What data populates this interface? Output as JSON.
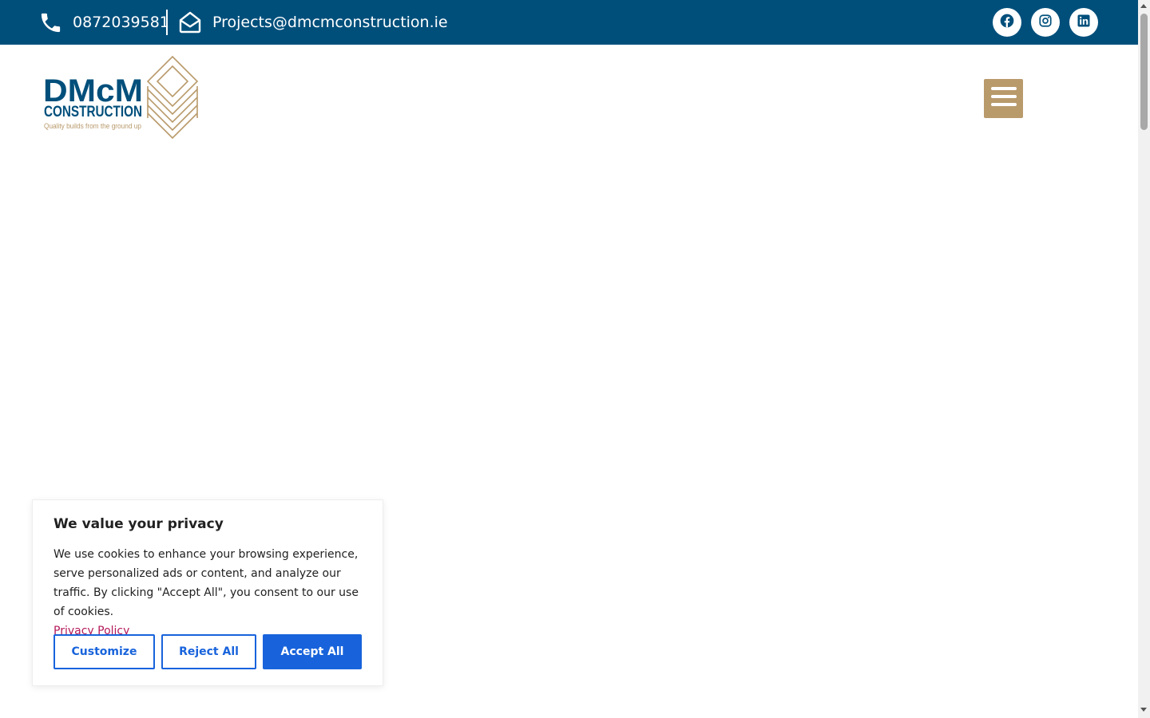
{
  "topbar": {
    "phone": "0872039581",
    "email": "Projects@dmcmconstruction.ie",
    "background": "#004f7b",
    "icons": {
      "phone": "phone-icon",
      "email": "envelope-open-icon",
      "facebook": "facebook-icon",
      "instagram": "instagram-icon",
      "linkedin": "linkedin-icon"
    }
  },
  "logo": {
    "line1": "DMcM",
    "line2": "CONSTRUCTION",
    "tagline": "Quality builds from the ground up"
  },
  "header": {
    "menu_icon": "hamburger-menu-icon",
    "menu_color": "#b99a6b"
  },
  "cookie": {
    "title": "We value your privacy",
    "description": "We use cookies to enhance your browsing experience, serve personalized ads or content, and analyze our traffic. By clicking \"Accept All\", you consent to our use of cookies.",
    "policy_link": "Privacy Policy",
    "customize_label": "Customize",
    "reject_label": "Reject All",
    "accept_label": "Accept All",
    "accent": "#1863dc",
    "link_color": "#b5195b"
  }
}
